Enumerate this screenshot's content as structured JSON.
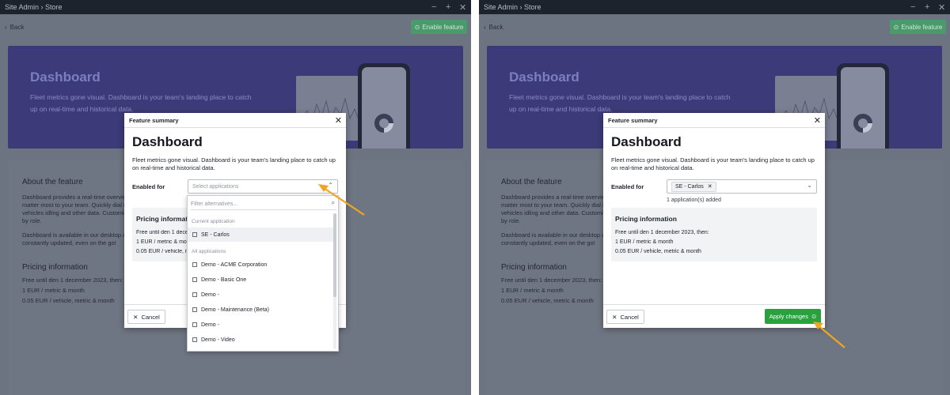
{
  "window": {
    "title": "Site Admin › Store",
    "minimize": "−",
    "maximize": "+",
    "close": "✕"
  },
  "toolbar": {
    "back_label": "Back",
    "enable_label": "Enable feature"
  },
  "hero": {
    "title": "Dashboard",
    "subtitle": "Fleet metrics gone visual. Dashboard is your team's landing place to catch up on real-time and historical data."
  },
  "about": {
    "title": "About the feature",
    "text": "Dashboard provides a real-time overview of the metrics that matter most to your team. Quickly dial in on the number of vehicles idling and other data. Customize your dashboard by role.",
    "text2": "Dashboard is available in our desktop and mobile apps, constantly updated, even on the go!"
  },
  "bg_pricing": {
    "title": "Pricing information",
    "line1": "Free until den 1 december 2023, then:",
    "line2": "1 EUR / metric & month",
    "line3": "0.05 EUR / vehicle, metric & month"
  },
  "modal": {
    "header": "Feature summary",
    "title": "Dashboard",
    "description": "Fleet metrics gone visual. Dashboard is your team's landing place to catch up on real-time and historical data.",
    "enabled_for_label": "Enabled for",
    "select_placeholder": "Select applications",
    "chip_label": "SE - Carlos",
    "added_note": "1 application(s) added",
    "pricing": {
      "title": "Pricing information",
      "line1": "Free until den 1 december 2023, then:",
      "line2": "1 EUR / metric & month",
      "line3": "0.05 EUR / vehicle, metric & month"
    },
    "cancel_label": "Cancel",
    "apply_label": "Apply changes"
  },
  "dropdown": {
    "filter_placeholder": "Filter alternatives...",
    "current_group": "Current application",
    "current_items": [
      "SE - Carlos"
    ],
    "all_group": "All applications",
    "all_items": [
      "Demo - ACME Corporation",
      "Demo - Basic One",
      "Demo -",
      "Demo - Maintenance (Beta)",
      "Demo -",
      "Demo - Video"
    ]
  },
  "colors": {
    "accent_green": "#29a23d",
    "hero_purple": "#3c3a78",
    "highlight_arrow": "#f0a522"
  }
}
